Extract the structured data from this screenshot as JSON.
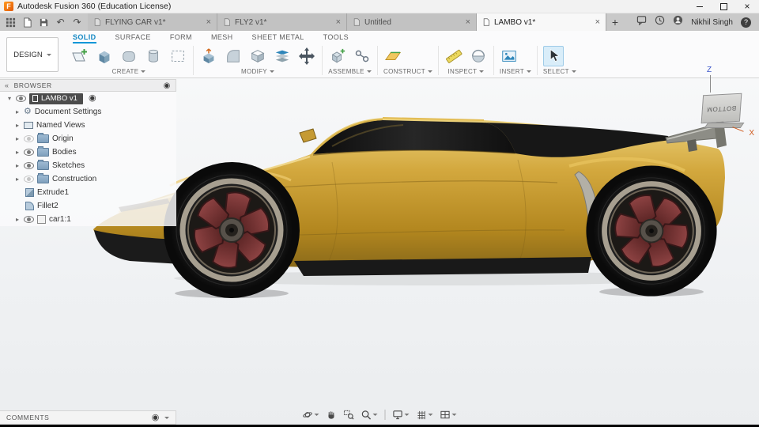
{
  "titlebar": {
    "app_title": "Autodesk Fusion 360 (Education License)"
  },
  "tabbar": {
    "tabs": [
      {
        "label": "FLYING CAR v1*"
      },
      {
        "label": "FLY2 v1*"
      },
      {
        "label": "Untitled"
      },
      {
        "label": "LAMBO v1*"
      }
    ],
    "user_name": "Nikhil Singh"
  },
  "ribbon": {
    "design_label": "DESIGN",
    "tabs": [
      "SOLID",
      "SURFACE",
      "FORM",
      "MESH",
      "SHEET METAL",
      "TOOLS"
    ],
    "groups": [
      "CREATE",
      "MODIFY",
      "ASSEMBLE",
      "CONSTRUCT",
      "INSPECT",
      "INSERT",
      "SELECT"
    ]
  },
  "browser": {
    "header": "BROWSER",
    "root_label": "LAMBO v1",
    "items": [
      {
        "label": "Document Settings"
      },
      {
        "label": "Named Views"
      },
      {
        "label": "Origin"
      },
      {
        "label": "Bodies"
      },
      {
        "label": "Sketches"
      },
      {
        "label": "Construction"
      },
      {
        "label": "Extrude1"
      },
      {
        "label": "Fillet2"
      },
      {
        "label": "car1:1"
      }
    ]
  },
  "viewcube": {
    "face_label": "BOTTOM",
    "axis_z": "Z",
    "axis_x": "X"
  },
  "comments": {
    "header": "COMMENTS"
  },
  "glyphs": {
    "close": "×",
    "add_tab": "+",
    "undo": "↶",
    "redo": "↷",
    "tree_collapsed": "▸",
    "tree_expanded": "▾",
    "panel_collapse": "«",
    "target_dot": "◉",
    "gear": "⚙",
    "help": "?"
  },
  "icon_map": {
    "app-grid-icon": "3x3-squares",
    "file-menu-icon": "page",
    "save-icon": "floppy",
    "undo-icon": "↶",
    "redo-icon": "↷",
    "tab-doc-icon": "page",
    "comment-bubble-icon": "speech-bubble",
    "job-status-icon": "clock-circle",
    "avatar-icon": "person-circle",
    "help-icon": "?-circle",
    "create-sketch-icon": "plane+green-plus",
    "extrude-box-icon": "cube",
    "form-icon": "rounded-cube",
    "cylinder-icon": "cylinder",
    "pattern-icon": "dashed-rect",
    "press-pull-icon": "cube+arrow",
    "fillet-icon": "rounded-corner-block",
    "shell-icon": "open-box",
    "combine-icon": "stacked-sheets",
    "move-icon": "four-way-arrows",
    "new-component-icon": "cube+green-plus",
    "joint-icon": "two-pins",
    "construction-plane-icon": "orange-plane",
    "measure-icon": "yellow-ruler",
    "section-icon": "half-dome",
    "insert-canvas-icon": "picture",
    "select-cursor-icon": "arrow-cursor",
    "eye-icon": "eye-outline",
    "folder-icon": "blue-folder",
    "gear-icon": "⚙",
    "orbit-icon": "circle-orbit",
    "pan-icon": "hand",
    "zoom-window-icon": "dashed-rect+magnifier",
    "zoom-icon": "magnifier",
    "display-settings-icon": "monitor",
    "grid-settings-icon": "grid",
    "viewports-icon": "split-rect"
  },
  "colors": {
    "accent_blue": "#0696d7",
    "body_gold": "#c9992f",
    "wheel_maroon": "#7d3636",
    "select_highlight": "#d9edf9"
  }
}
